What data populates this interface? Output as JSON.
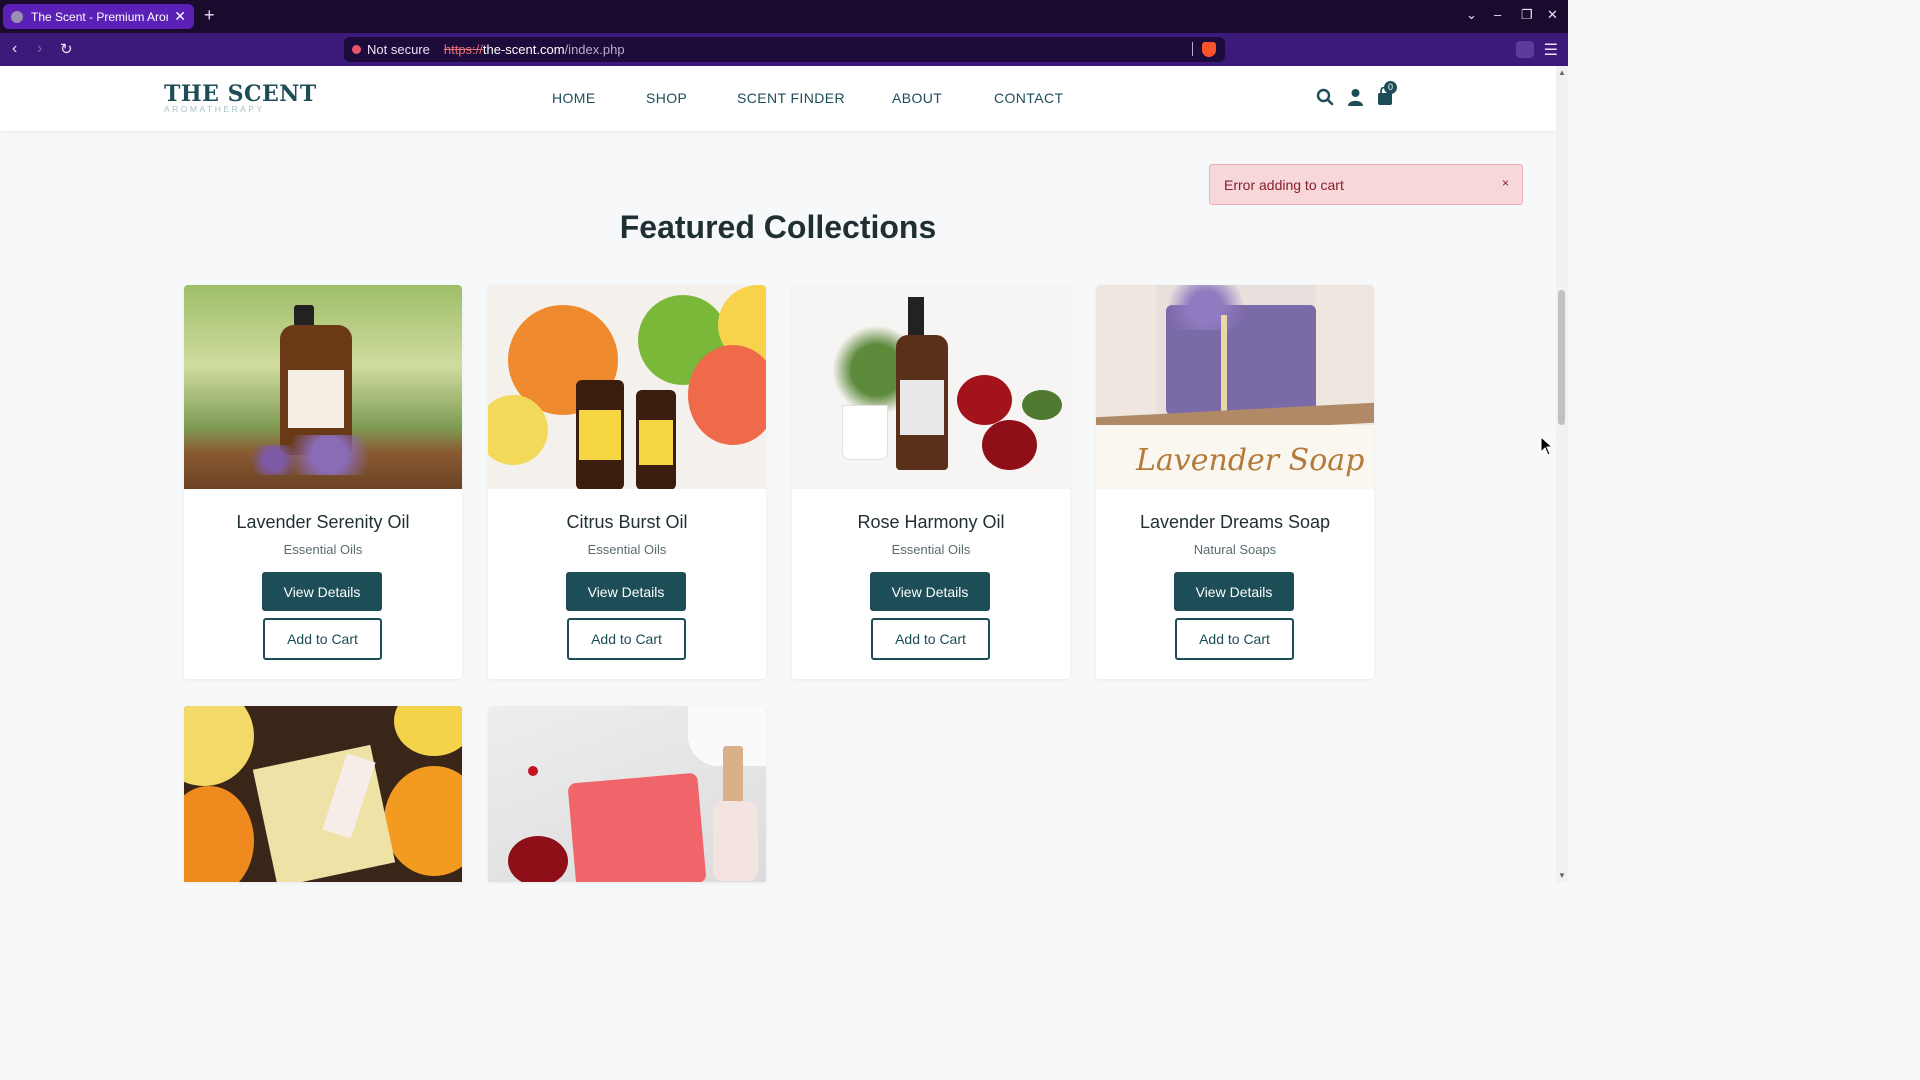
{
  "browser": {
    "tab_title": "The Scent - Premium Arom",
    "not_secure": "Not secure",
    "url_scheme": "https://",
    "url_host": "the-scent.com",
    "url_path": "/index.php"
  },
  "header": {
    "logo": "THE SCENT",
    "logo_sub": "AROMATHERAPY",
    "nav": [
      "HOME",
      "SHOP",
      "SCENT FINDER",
      "ABOUT",
      "CONTACT"
    ],
    "cart_count": "0"
  },
  "toast": {
    "message": "Error adding to cart",
    "close": "×"
  },
  "section": {
    "title": "Featured Collections"
  },
  "products": [
    {
      "name": "Lavender Serenity Oil",
      "category": "Essential Oils",
      "view_label": "View Details",
      "add_label": "Add to Cart"
    },
    {
      "name": "Citrus Burst Oil",
      "category": "Essential Oils",
      "view_label": "View Details",
      "add_label": "Add to Cart"
    },
    {
      "name": "Rose Harmony Oil",
      "category": "Essential Oils",
      "view_label": "View Details",
      "add_label": "Add to Cart"
    },
    {
      "name": "Lavender Dreams Soap",
      "category": "Natural Soaps",
      "view_label": "View Details",
      "add_label": "Add to Cart"
    }
  ],
  "image_text": {
    "soap_banner": "Lavender Soap"
  },
  "colors": {
    "brand": "#1d4d57",
    "error_bg": "#f8d7da",
    "error_text": "#842029"
  }
}
